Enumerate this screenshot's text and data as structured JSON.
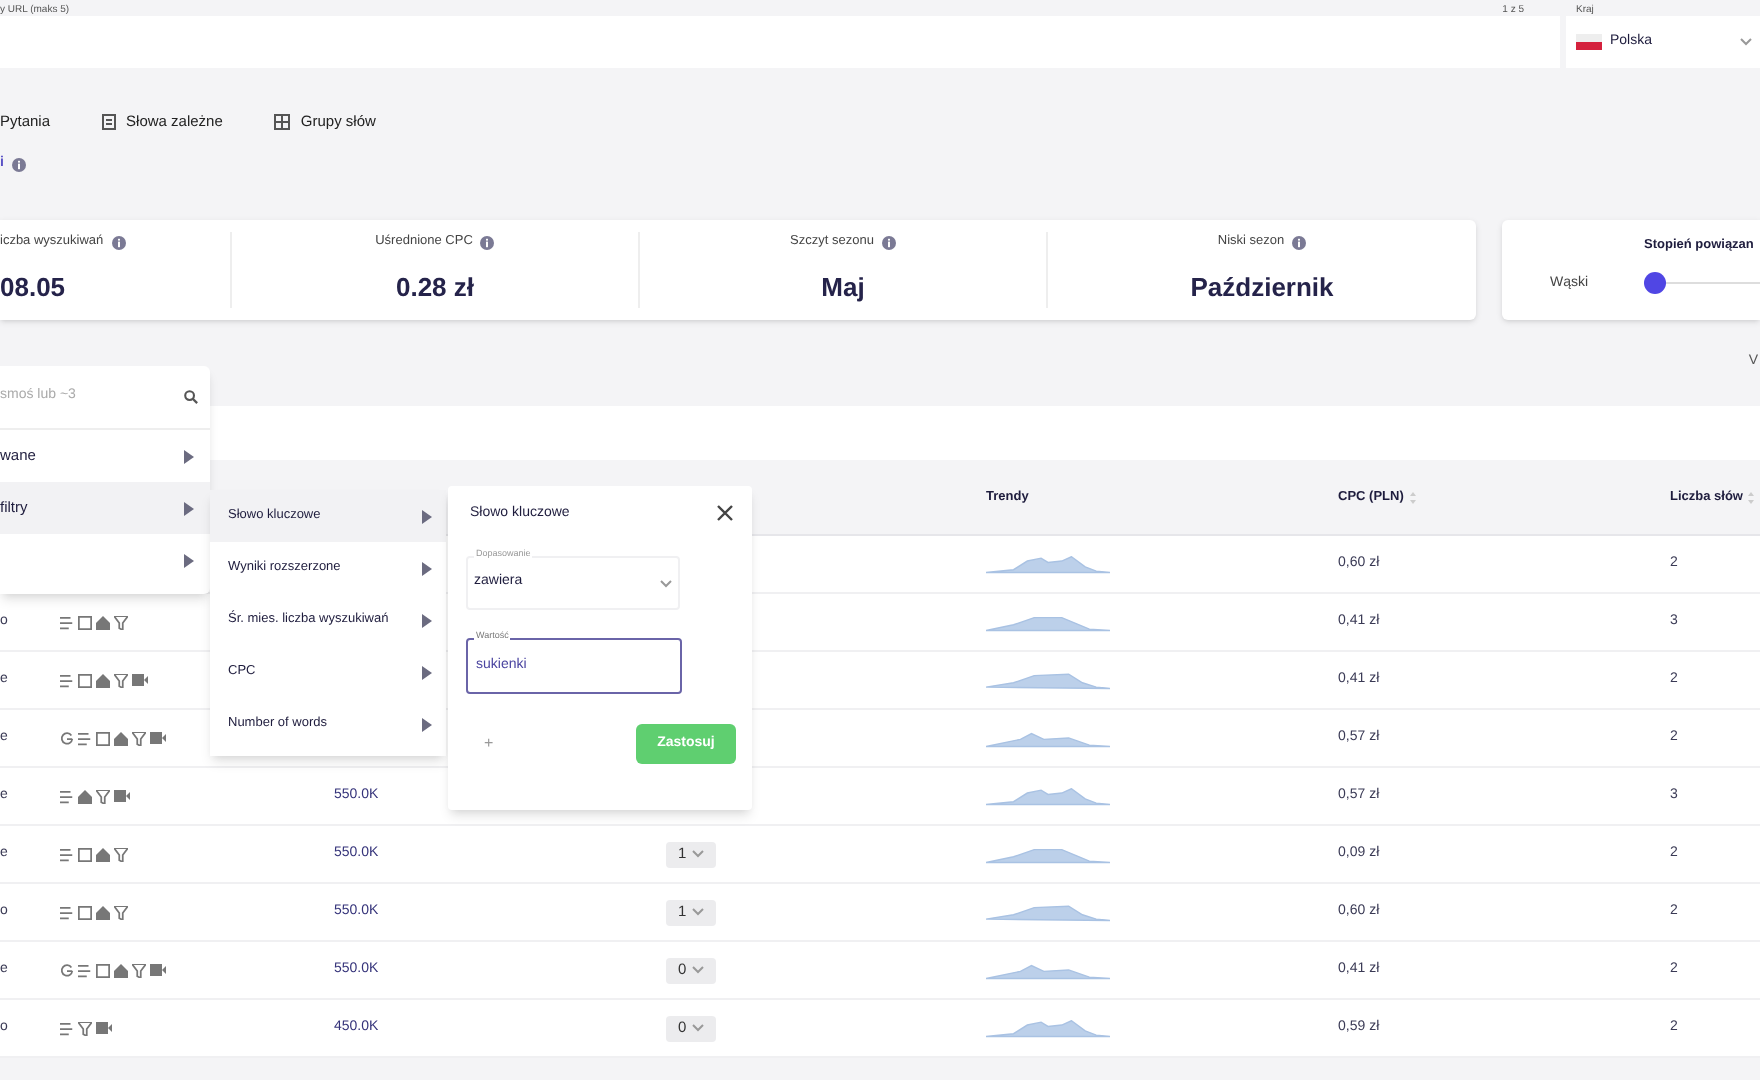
{
  "url_field": {
    "label": "y URL (maks 5)",
    "counter": "1 z 5"
  },
  "country": {
    "label": "Kraj",
    "value": "Polska"
  },
  "tabs": [
    {
      "label": "Pytania"
    },
    {
      "label": "Słowa zależne"
    },
    {
      "label": "Grupy słów"
    }
  ],
  "section_title": "i",
  "stats": [
    {
      "label": "iczba wyszukiwań",
      "value": "08.05"
    },
    {
      "label": "Uśrednione CPC",
      "value": "0.28 zł"
    },
    {
      "label": "Szczyt sezonu",
      "value": "Maj"
    },
    {
      "label": "Niski sezon",
      "value": "Październik"
    }
  ],
  "relation": {
    "title": "Stopień powiązan",
    "min_label": "Wąski",
    "level": 0
  },
  "toolbar_text": "V",
  "table": {
    "columns": [
      {
        "label": "Trendy"
      },
      {
        "label": "CPC (PLN)"
      },
      {
        "label": "Liczba słów"
      }
    ],
    "rows": [
      {
        "cpc": "0,60 zł",
        "words": "2"
      },
      {
        "keyword": "o",
        "cpc": "0,41 zł",
        "words": "3"
      },
      {
        "keyword": "e",
        "cpc": "0,41 zł",
        "words": "2"
      },
      {
        "keyword": "e",
        "cpc": "0,57 zł",
        "words": "2"
      },
      {
        "keyword": "e",
        "volume": "550.0K",
        "cpc": "0,57 zł",
        "words": "3"
      },
      {
        "keyword": "e",
        "volume": "550.0K",
        "difficulty": "1",
        "cpc": "0,09 zł",
        "words": "2"
      },
      {
        "keyword": "o",
        "volume": "550.0K",
        "difficulty": "1",
        "cpc": "0,60 zł",
        "words": "2"
      },
      {
        "keyword": "e",
        "volume": "550.0K",
        "difficulty": "0",
        "cpc": "0,41 zł",
        "words": "2"
      },
      {
        "keyword": "o",
        "volume": "450.0K",
        "difficulty": "0",
        "cpc": "0,59 zł",
        "words": "2"
      }
    ]
  },
  "menu": {
    "search_placeholder": "smoś lub ~3",
    "items": [
      {
        "label": "wane",
        "selected": false
      },
      {
        "label": "filtry",
        "selected": true
      },
      {
        "selected": false
      }
    ]
  },
  "submenu": {
    "items": [
      {
        "label": "Słowo kluczowe",
        "selected": true
      },
      {
        "label": "Wyniki rozszerzone",
        "selected": false
      },
      {
        "label": "Śr. mies. liczba wyszukiwań",
        "selected": false
      },
      {
        "label": "CPC",
        "selected": false
      },
      {
        "label": "Number of words",
        "selected": false
      }
    ]
  },
  "filter_popover": {
    "title": "Słowo kluczowe",
    "match": {
      "label": "Dopasowanie",
      "value": "zawiera"
    },
    "value_field": {
      "label": "Wartość",
      "value": "sukienki",
      "focused": true
    },
    "add_label": "+",
    "apply_label": "Zastosuj"
  }
}
